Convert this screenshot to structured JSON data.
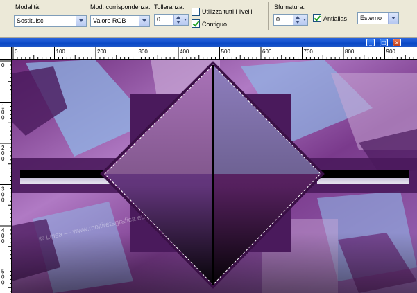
{
  "options": {
    "mode_label": "Modalità:",
    "mode_value": "Sostituisci",
    "match_label": "Mod. corrispondenza:",
    "match_value": "Valore RGB",
    "tolerance_label": "Tolleranza:",
    "tolerance_value": "0",
    "use_all_layers_label": "Utilizza tutti i livelli",
    "use_all_layers_checked": false,
    "contiguous_label": "Contiguo",
    "contiguous_checked": true,
    "feather_label": "Sfumatura:",
    "feather_value": "0",
    "antialias_label": "Antialias",
    "antialias_checked": true,
    "antialias_mode_value": "Esterno"
  },
  "window": {
    "buttons": [
      "_",
      "□",
      "×"
    ]
  },
  "ruler": {
    "h_labels": [
      "0",
      "100",
      "200",
      "300",
      "400",
      "500",
      "600",
      "700",
      "800",
      "900"
    ],
    "v_labels": [
      "0",
      "1\n0\n0",
      "2\n0\n0",
      "3\n0\n0",
      "4\n0\n0",
      "5\n0\n0"
    ]
  },
  "canvas": {
    "watermark": "© Luisa — www.moltiretagrafica.eu",
    "colors": {
      "deep_purple": "#4a1a5c",
      "mid_purple": "#8c3a8f",
      "violet": "#6a2878",
      "light_blue": "#8fb6e6",
      "lavender": "#c9a8d6",
      "black": "#000000"
    }
  }
}
